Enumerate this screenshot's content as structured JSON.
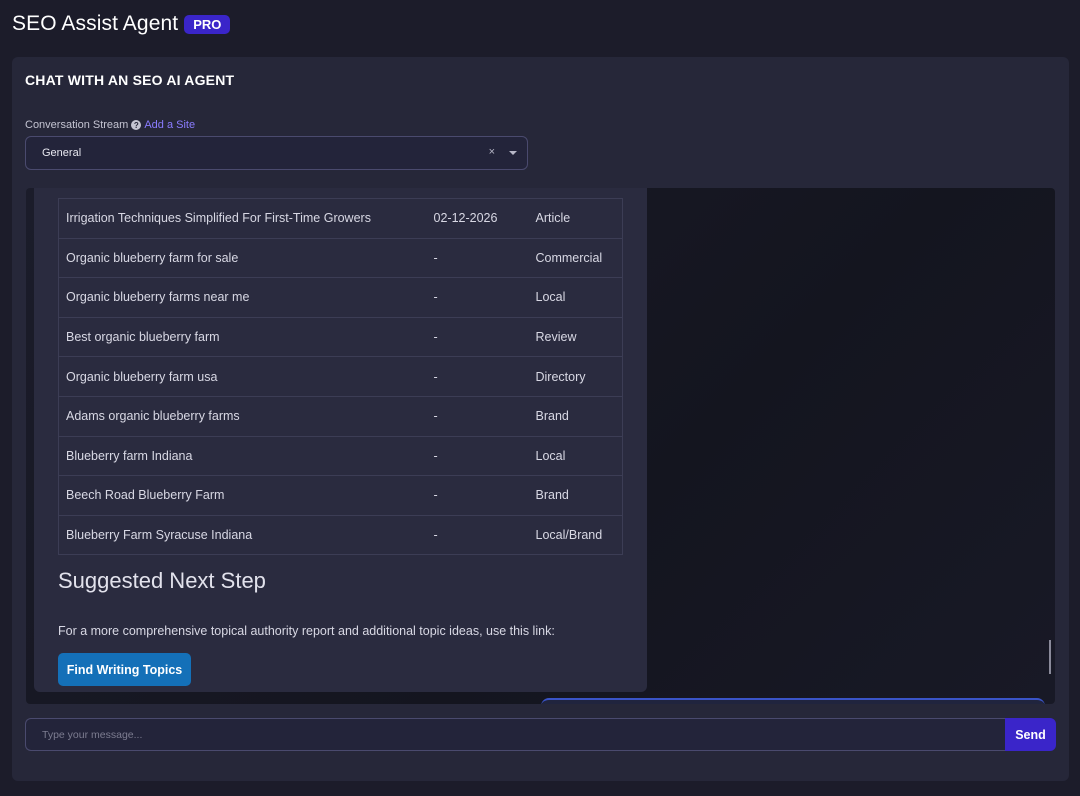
{
  "header": {
    "app_title": "SEO Assist Agent",
    "badge": "PRO"
  },
  "panel": {
    "heading": "CHAT WITH AN SEO AI AGENT",
    "stream_label": "Conversation Stream",
    "add_site_link": "Add a Site",
    "help_icon": "question-circle-icon",
    "select": {
      "selected_value": "General",
      "clear_glyph": "×"
    }
  },
  "chat": {
    "table": {
      "rows": [
        {
          "keyword": "Irrigation Techniques Simplified For First-Time Growers",
          "date": "02-12-2026",
          "type": "Article"
        },
        {
          "keyword": "Organic blueberry farm for sale",
          "date": "-",
          "type": "Commercial"
        },
        {
          "keyword": "Organic blueberry farms near me",
          "date": "-",
          "type": "Local"
        },
        {
          "keyword": "Best organic blueberry farm",
          "date": "-",
          "type": "Review"
        },
        {
          "keyword": "Organic blueberry farm usa",
          "date": "-",
          "type": "Directory"
        },
        {
          "keyword": "Adams organic blueberry farms",
          "date": "-",
          "type": "Brand"
        },
        {
          "keyword": "Blueberry farm Indiana",
          "date": "-",
          "type": "Local"
        },
        {
          "keyword": "Beech Road Blueberry Farm",
          "date": "-",
          "type": "Brand"
        },
        {
          "keyword": "Blueberry Farm Syracuse Indiana",
          "date": "-",
          "type": "Local/Brand"
        }
      ]
    },
    "next_step_heading": "Suggested Next Step",
    "next_step_text": "For a more comprehensive topical authority report and additional topic ideas, use this link:",
    "find_topics_label": "Find Writing Topics"
  },
  "composer": {
    "placeholder": "Type your message...",
    "send_label": "Send"
  },
  "colors": {
    "accent": "#3a25c9",
    "button_blue": "#1470b8",
    "link": "#8a7cff"
  }
}
